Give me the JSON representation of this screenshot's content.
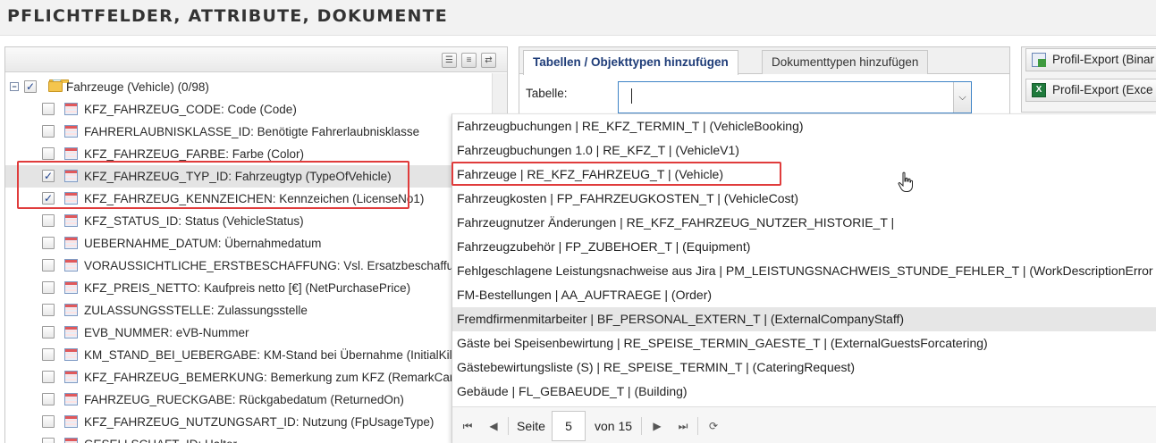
{
  "header": {
    "title": "PFLICHTFELDER, ATTRIBUTE, DOKUMENTE"
  },
  "tree": {
    "toolbar_icons": [
      "list-view-icon",
      "tree-view-icon",
      "refresh-icon"
    ],
    "root": {
      "label": "Fahrzeuge (Vehicle) (0/98)",
      "expanded": true,
      "checked": true
    },
    "items": [
      {
        "label": "KFZ_FAHRZEUG_CODE: Code (Code)",
        "checked": false
      },
      {
        "label": "FAHRERLAUBNISKLASSE_ID: Benötigte Fahrerlaubnisklasse",
        "checked": false
      },
      {
        "label": "KFZ_FAHRZEUG_FARBE: Farbe (Color)",
        "checked": false
      },
      {
        "label": "KFZ_FAHRZEUG_TYP_ID: Fahrzeugtyp (TypeOfVehicle)",
        "checked": true
      },
      {
        "label": "KFZ_FAHRZEUG_KENNZEICHEN: Kennzeichen (LicenseNo1)",
        "checked": true
      },
      {
        "label": "KFZ_STATUS_ID: Status (VehicleStatus)",
        "checked": false
      },
      {
        "label": "UEBERNAHME_DATUM: Übernahmedatum",
        "checked": false
      },
      {
        "label": "VORAUSSICHTLICHE_ERSTBESCHAFFUNG: Vsl. Ersatzbeschaffung",
        "checked": false
      },
      {
        "label": "KFZ_PREIS_NETTO: Kaufpreis netto [€] (NetPurchasePrice)",
        "checked": false
      },
      {
        "label": "ZULASSUNGSSTELLE: Zulassungsstelle",
        "checked": false
      },
      {
        "label": "EVB_NUMMER: eVB-Nummer",
        "checked": false
      },
      {
        "label": "KM_STAND_BEI_UEBERGABE: KM-Stand bei Übernahme (InitialKilome",
        "checked": false
      },
      {
        "label": "KFZ_FAHRZEUG_BEMERKUNG: Bemerkung zum KFZ (RemarkCar)",
        "checked": false
      },
      {
        "label": "FAHRZEUG_RUECKGABE: Rückgabedatum (ReturnedOn)",
        "checked": false
      },
      {
        "label": "KFZ_FAHRZEUG_NUTZUNGSART_ID: Nutzung (FpUsageType)",
        "checked": false
      },
      {
        "label": "GESELLSCHAFT_ID: Halter",
        "checked": false
      }
    ]
  },
  "tabs": [
    {
      "label": "Tabellen / Objekttypen hinzufügen",
      "active": true
    },
    {
      "label": "Dokumenttypen hinzufügen",
      "active": false
    }
  ],
  "form": {
    "table_label": "Tabelle:",
    "table_value": ""
  },
  "export": [
    {
      "label": "Profil-Export (Binar",
      "icon": "binary-export-icon"
    },
    {
      "label": "Profil-Export (Exce",
      "icon": "excel-icon"
    }
  ],
  "dropdown": {
    "items": [
      "Fahrzeugbuchungen | RE_KFZ_TERMIN_T | (VehicleBooking)",
      "Fahrzeugbuchungen 1.0 | RE_KFZ_T | (VehicleV1)",
      "Fahrzeuge | RE_KFZ_FAHRZEUG_T | (Vehicle)",
      "Fahrzeugkosten | FP_FAHRZEUGKOSTEN_T | (VehicleCost)",
      "Fahrzeugnutzer Änderungen | RE_KFZ_FAHRZEUG_NUTZER_HISTORIE_T |",
      "Fahrzeugzubehör | FP_ZUBEHOER_T | (Equipment)",
      "Fehlgeschlagene Leistungsnachweise aus Jira | PM_LEISTUNGSNACHWEIS_STUNDE_FEHLER_T | (WorkDescriptionError",
      "FM-Bestellungen | AA_AUFTRAEGE | (Order)",
      "Fremdfirmenmitarbeiter | BF_PERSONAL_EXTERN_T | (ExternalCompanyStaff)",
      "Gäste bei Speisenbewirtung | RE_SPEISE_TERMIN_GAESTE_T | (ExternalGuestsForcatering)",
      "Gästebewirtungsliste (S) | RE_SPEISE_TERMIN_T | (CateringRequest)",
      "Gebäude | FL_GEBAEUDE_T | (Building)"
    ],
    "hovered_index": 8
  },
  "pager": {
    "page_label": "Seite",
    "page_value": "5",
    "of_label": "von 15"
  },
  "colors": {
    "accent": "#1e3c78",
    "highlight_box": "#e03c3c",
    "hover_row": "#e6e6e6"
  }
}
